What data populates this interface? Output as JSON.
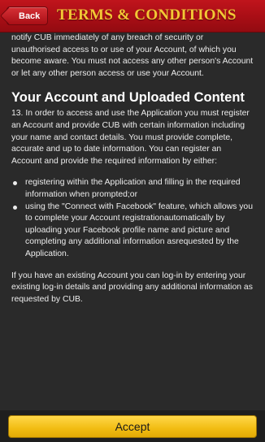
{
  "header": {
    "back_label": "Back",
    "title": "TERMS & CONDITIONS"
  },
  "content": {
    "intro_paragraph": "notify CUB immediately of any breach of security or unauthorised access to or use of your Account, of which you become aware. You must not access any other person's Account or let any other person access or use your Account.",
    "section_heading": "Your Account and Uploaded Content",
    "section_paragraph": "13. In order to access and use the Application you must register an Account and provide CUB with certain information including your name and contact details. You must provide complete, accurate and up to date information. You can register an Account and provide the required information by either:",
    "bullets": [
      "registering within the Application and filling in the required information when prompted;or",
      "using the \"Connect with Facebook\" feature, which allows you to complete your Account registrationautomatically by uploading your Facebook profile name and picture and completing any additional information asrequested by the Application."
    ],
    "closing_paragraph": "If you have an existing Account you can log-in by entering your existing log-in details and providing any additional information as requested by CUB."
  },
  "footer": {
    "accept_label": "Accept"
  },
  "colors": {
    "header_red": "#a80e15",
    "title_gold": "#f3c735",
    "background": "#2a2a2a",
    "accept_yellow": "#f1bc12"
  },
  "icons": {
    "back": "back-arrow-button",
    "bullet": "bullet-dot"
  }
}
